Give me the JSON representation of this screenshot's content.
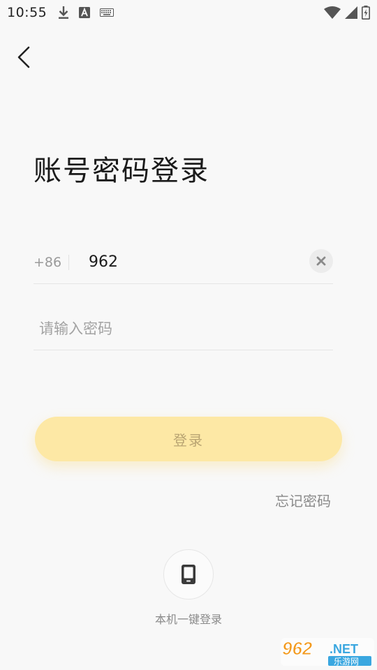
{
  "status_bar": {
    "time": "10:55",
    "left_icons": [
      "download-icon",
      "a-letter-icon",
      "keyboard-icon"
    ],
    "right_icons": [
      "wifi-icon",
      "signal-icon",
      "battery-charging-icon"
    ]
  },
  "title": "账号密码登录",
  "phone": {
    "country_code": "+86",
    "value": "962"
  },
  "password": {
    "placeholder": "请输入密码",
    "value": ""
  },
  "login_button": "登录",
  "forgot_password": "忘记密码",
  "one_tap": {
    "icon": "mobile-phone-icon",
    "label": "本机一键登录"
  },
  "watermark": {
    "number": "962",
    "suffix": ".NET",
    "subtitle": "乐游网"
  },
  "colors": {
    "background": "#f8f8f8",
    "login_button_bg": "#fde8a5",
    "login_button_text": "#b9a472",
    "text_primary": "#1b1b1b",
    "text_secondary": "#8a8a8a"
  }
}
